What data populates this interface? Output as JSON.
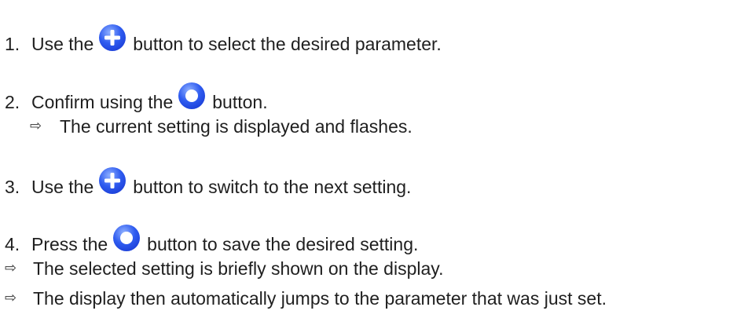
{
  "steps": [
    {
      "number": "1.",
      "before": "Use the",
      "icon": "plus-button-icon",
      "after": "button to select the desired parameter."
    },
    {
      "number": "2.",
      "before": "Confirm using the",
      "icon": "ring-button-icon",
      "after": "button."
    },
    {
      "number": "3.",
      "before": "Use the",
      "icon": "plus-button-icon",
      "after": "button to switch to the next setting."
    },
    {
      "number": "4.",
      "before": "Press the",
      "icon": "ring-button-icon",
      "after": "button to save the desired setting."
    }
  ],
  "step2_result": "The current setting is displayed and flashes.",
  "results": [
    "The selected setting is briefly shown on the display.",
    "The display then automatically jumps to the parameter that was just set."
  ],
  "arrow_symbol": "⇨",
  "colors": {
    "button_blue": "#1c3fd8",
    "button_light": "#8fb0ff"
  }
}
